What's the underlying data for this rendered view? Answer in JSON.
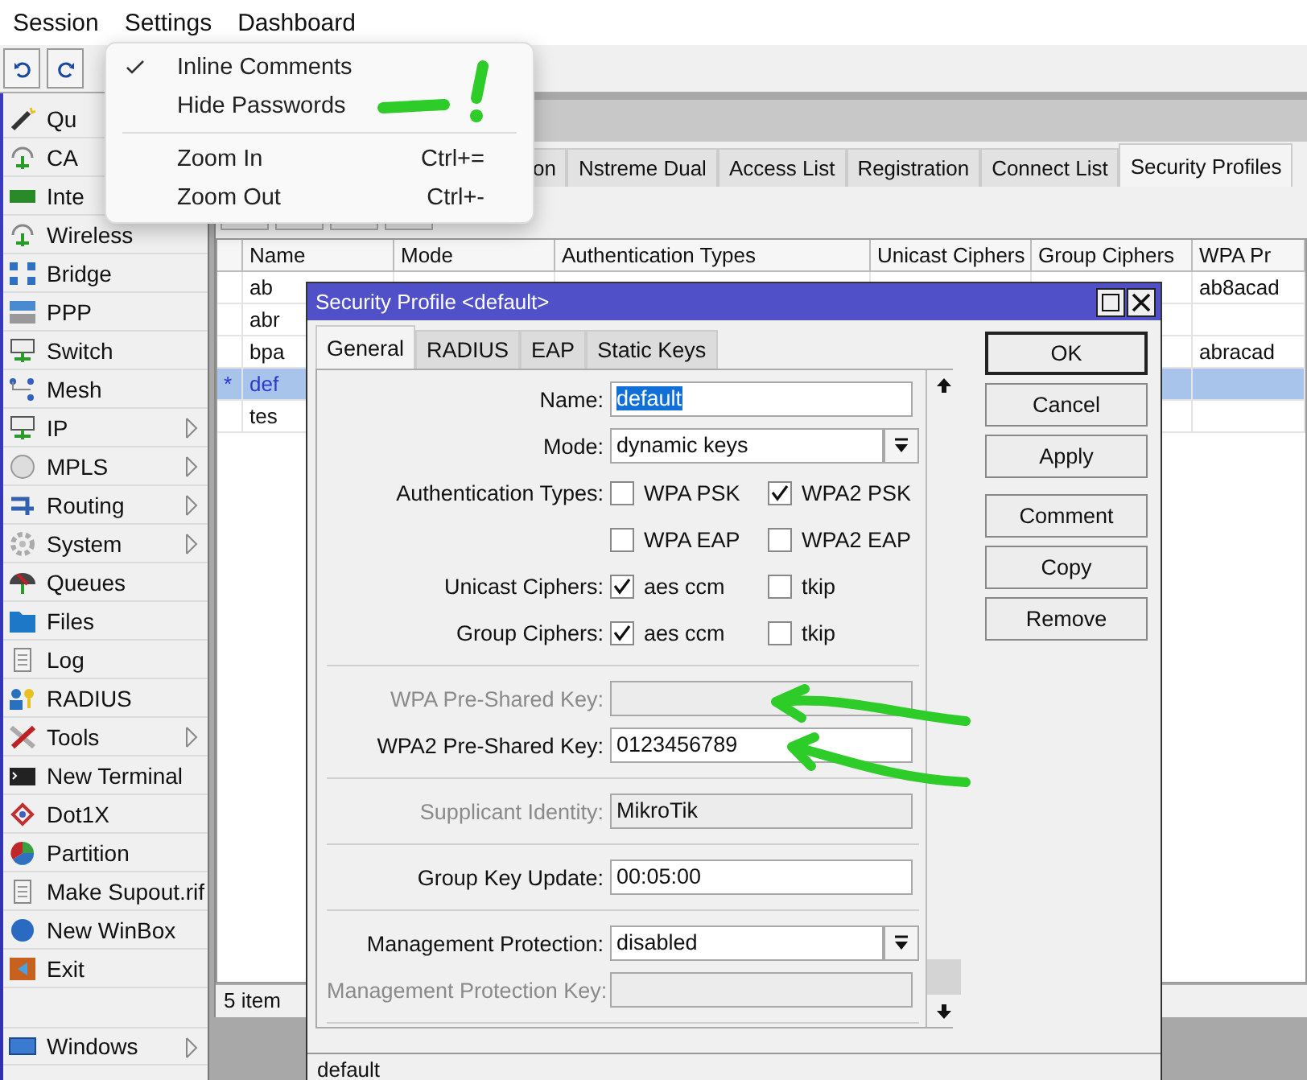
{
  "menu_bar": [
    "Session",
    "Settings",
    "Dashboard"
  ],
  "settings_menu": {
    "groups": [
      [
        {
          "label": "Inline Comments",
          "checked": true
        },
        {
          "label": "Hide Passwords",
          "checked": false
        }
      ],
      [
        {
          "label": "Zoom In",
          "checked": false,
          "shortcut": "Ctrl+="
        },
        {
          "label": "Zoom Out",
          "checked": false,
          "shortcut": "Ctrl+-"
        }
      ]
    ]
  },
  "sidebar": {
    "items": [
      {
        "label": "Qu"
      },
      {
        "label": "CA"
      },
      {
        "label": "Inte"
      },
      {
        "label": "Wireless",
        "submenu": false
      },
      {
        "label": "Bridge",
        "submenu": false
      },
      {
        "label": "PPP",
        "submenu": false
      },
      {
        "label": "Switch",
        "submenu": false
      },
      {
        "label": "Mesh",
        "submenu": false
      },
      {
        "label": "IP",
        "submenu": true
      },
      {
        "label": "MPLS",
        "submenu": true
      },
      {
        "label": "Routing",
        "submenu": true
      },
      {
        "label": "System",
        "submenu": true
      },
      {
        "label": "Queues",
        "submenu": false
      },
      {
        "label": "Files",
        "submenu": false
      },
      {
        "label": "Log",
        "submenu": false
      },
      {
        "label": "RADIUS",
        "submenu": false
      },
      {
        "label": "Tools",
        "submenu": true
      },
      {
        "label": "New Terminal",
        "submenu": false
      },
      {
        "label": "Dot1X",
        "submenu": false
      },
      {
        "label": "Partition",
        "submenu": false
      },
      {
        "label": "Make Supout.rif",
        "submenu": false
      },
      {
        "label": "New WinBox",
        "submenu": false
      },
      {
        "label": "Exit",
        "submenu": false
      }
    ],
    "footer": {
      "label": "Windows",
      "submenu": true
    }
  },
  "wireless_window": {
    "tabs": [
      {
        "label": "on",
        "selected": false
      },
      {
        "label": "Nstreme Dual",
        "selected": false
      },
      {
        "label": "Access List",
        "selected": false
      },
      {
        "label": "Registration",
        "selected": false
      },
      {
        "label": "Connect List",
        "selected": false
      },
      {
        "label": "Security Profiles",
        "selected": true
      }
    ],
    "table": {
      "columns": [
        "Name",
        "Mode",
        "Authentication Types",
        "Unicast Ciphers",
        "Group Ciphers",
        "WPA Pr"
      ],
      "rows": [
        {
          "name": "ab",
          "wpa_key": "ab8acad",
          "selected": false
        },
        {
          "name": "abr",
          "selected": false
        },
        {
          "name": "bpa",
          "wpa_key": "abracad",
          "selected": false
        },
        {
          "flag": "*",
          "name": "def",
          "selected": true
        },
        {
          "name": "tes",
          "selected": false
        }
      ]
    },
    "status": "5 item"
  },
  "dialog": {
    "title": "Security Profile <default>",
    "tabs": [
      {
        "label": "General",
        "selected": true
      },
      {
        "label": "RADIUS",
        "selected": false
      },
      {
        "label": "EAP",
        "selected": false
      },
      {
        "label": "Static Keys",
        "selected": false
      }
    ],
    "fields": [
      {
        "kind": "text",
        "label": "Name:",
        "value": "default",
        "highlighted": true,
        "disabled": false
      },
      {
        "kind": "select",
        "label": "Mode:",
        "value": "dynamic keys"
      },
      {
        "kind": "checks",
        "label": "Authentication Types:",
        "options": [
          {
            "label": "WPA PSK",
            "checked": false
          },
          {
            "label": "WPA2 PSK",
            "checked": true
          }
        ]
      },
      {
        "kind": "checks",
        "options": [
          {
            "label": "WPA EAP",
            "checked": false
          },
          {
            "label": "WPA2 EAP",
            "checked": false
          }
        ]
      },
      {
        "kind": "checks",
        "label": "Unicast Ciphers:",
        "options": [
          {
            "label": "aes ccm",
            "checked": true
          },
          {
            "label": "tkip",
            "checked": false
          }
        ]
      },
      {
        "kind": "checks",
        "label": "Group Ciphers:",
        "options": [
          {
            "label": "aes ccm",
            "checked": true
          },
          {
            "label": "tkip",
            "checked": false
          }
        ]
      },
      {
        "kind": "divider"
      },
      {
        "kind": "text",
        "label": "WPA Pre-Shared Key:",
        "disabled": true
      },
      {
        "kind": "text",
        "label": "WPA2 Pre-Shared Key:",
        "value": "0123456789",
        "disabled": false
      },
      {
        "kind": "divider"
      },
      {
        "kind": "text",
        "label": "Supplicant Identity:",
        "value": "MikroTik",
        "disabled": true
      },
      {
        "kind": "divider"
      },
      {
        "kind": "text",
        "label": "Group Key Update:",
        "value": "00:05:00",
        "disabled": false
      },
      {
        "kind": "divider"
      },
      {
        "kind": "select",
        "label": "Management Protection:",
        "value": "disabled"
      },
      {
        "kind": "text",
        "label": "Management Protection Key:",
        "disabled": true
      },
      {
        "kind": "divider"
      }
    ],
    "button_groups": [
      [
        {
          "label": "OK",
          "default": true
        },
        {
          "label": "Cancel",
          "default": false
        },
        {
          "label": "Apply",
          "default": false
        }
      ],
      [
        {
          "label": "Comment",
          "default": false
        },
        {
          "label": "Copy",
          "default": false
        },
        {
          "label": "Remove",
          "default": false
        }
      ]
    ],
    "status": "default"
  }
}
